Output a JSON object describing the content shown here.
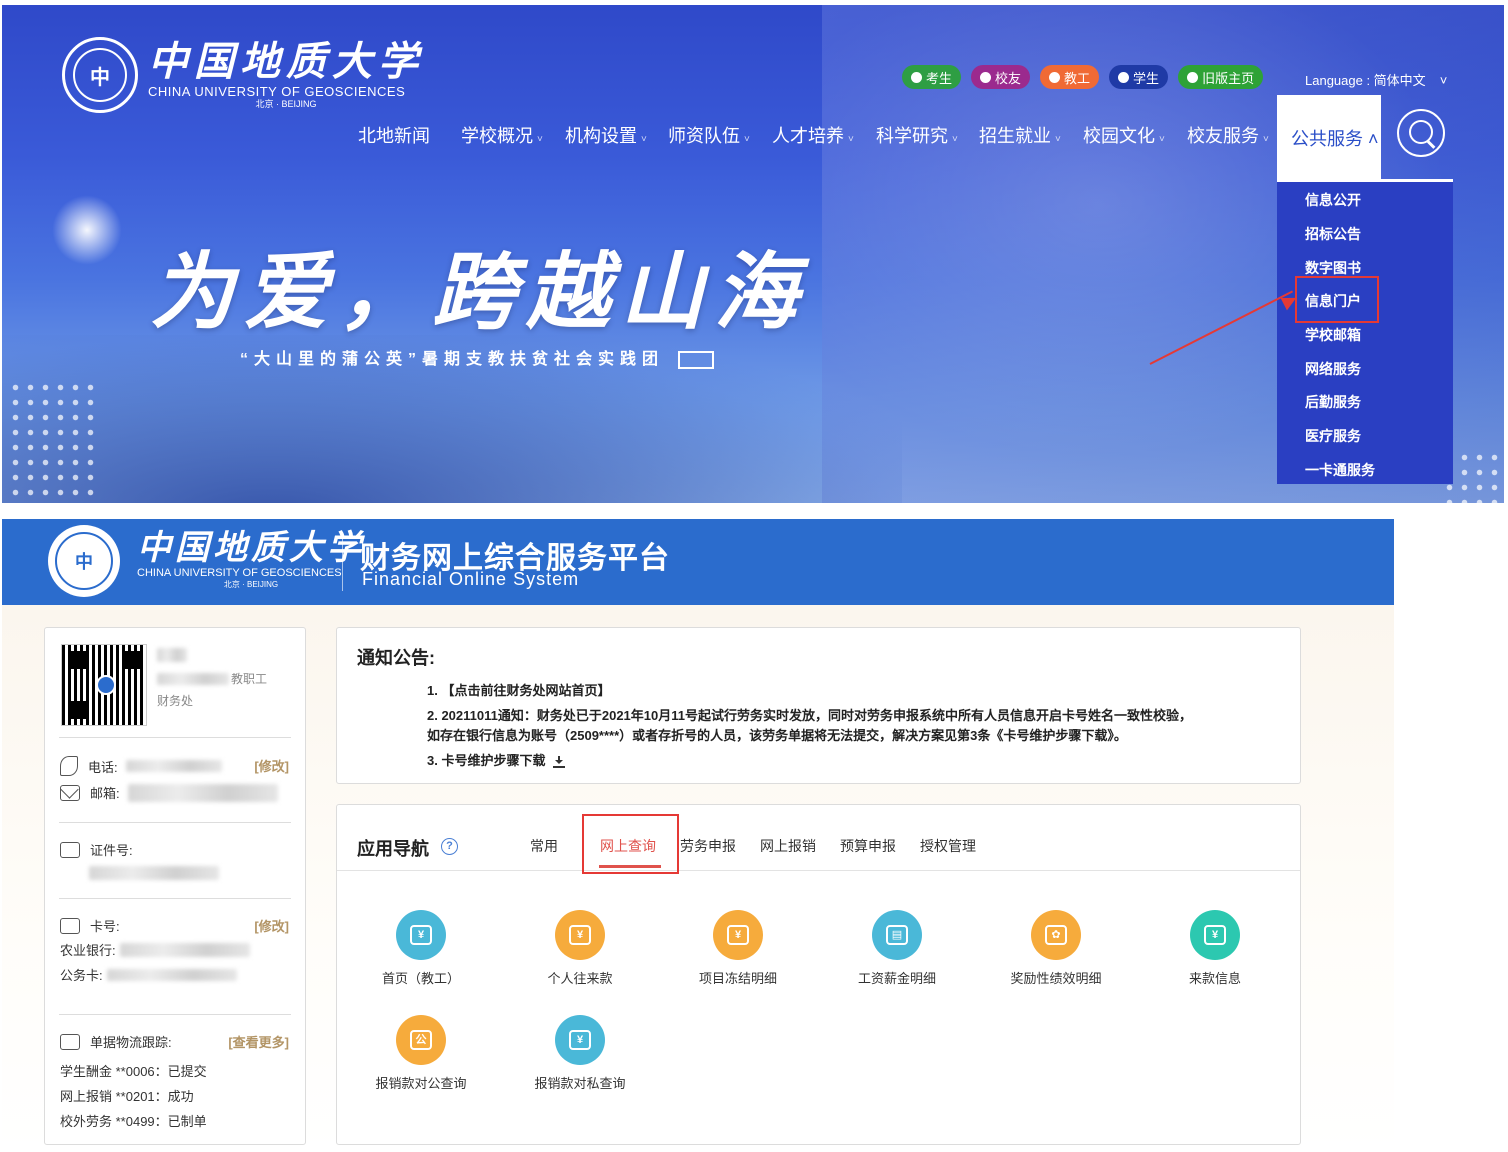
{
  "banner": {
    "logo": {
      "seal_text": "中",
      "cn": "中国地质大学",
      "en": "CHINA UNIVERSITY OF GEOSCIENCES",
      "city": "北京 · BEIJING"
    },
    "quick_links": [
      {
        "label": "考生",
        "color": "#2e9e43"
      },
      {
        "label": "校友",
        "color": "#9b2a8e"
      },
      {
        "label": "教工",
        "color": "#f06a35"
      },
      {
        "label": "学生",
        "color": "#1f3aa6"
      },
      {
        "label": "旧版主页",
        "color": "#2ea236"
      }
    ],
    "language": "Language : 简体中文",
    "language_chevron": "˅",
    "nav": [
      {
        "label": "北地新闻",
        "caret": ""
      },
      {
        "label": "学校概况",
        "caret": "˅"
      },
      {
        "label": "机构设置",
        "caret": "˅"
      },
      {
        "label": "师资队伍",
        "caret": "˅"
      },
      {
        "label": "人才培养",
        "caret": "˅"
      },
      {
        "label": "科学研究",
        "caret": "˅"
      },
      {
        "label": "招生就业",
        "caret": "˅"
      },
      {
        "label": "校园文化",
        "caret": "˅"
      },
      {
        "label": "校友服务",
        "caret": "˅"
      }
    ],
    "nav_active": "公共服务 ˄",
    "dropdown": [
      "信息公开",
      "招标公告",
      "数字图书",
      "信息门户",
      "学校邮箱",
      "网络服务",
      "后勤服务",
      "医疗服务",
      "一卡通服务"
    ],
    "slogan": "为爱，跨越山海",
    "sub_slogan": "“大山里的蒲公英”暑期支教扶贫社会实践团"
  },
  "finance": {
    "seal_text": "中",
    "cn": "中国地质大学",
    "en": "CHINA UNIVERSITY OF GEOSCIENCES",
    "city": "北京 · BEIJING",
    "title": "财务网上综合服务平台",
    "subtitle": "Financial Online System"
  },
  "profile": {
    "role": "教职工",
    "dept": "财务处",
    "phone_label": "电话:",
    "email_label": "邮箱:",
    "id_label": "证件号:",
    "card_label": "卡号:",
    "bank_label": "农业银行:",
    "official_card_label": "公务卡:",
    "modify": "[修改]",
    "track_label": "单据物流跟踪:",
    "view_more": "[查看更多]",
    "tracks": [
      "学生酬金 **0006：已提交",
      "网上报销 **0201：成功",
      "校外劳务 **0499：已制单"
    ]
  },
  "notice": {
    "title": "通知公告:",
    "lines": [
      "1. 【点击前往财务处网站首页】",
      "2. 20211011通知：财务处已于2021年10月11号起试行劳务实时发放，同时对劳务申报系统中所有人员信息开启卡号姓名一致性校验，",
      "如存在银行信息为账号（2509****）或者存折号的人员，该劳务单据将无法提交，解决方案见第3条《卡号维护步骤下载》。",
      "3. 卡号维护步骤下载"
    ]
  },
  "apps": {
    "title": "应用导航",
    "help": "?",
    "tabs": [
      "常用",
      "网上查询",
      "劳务申报",
      "网上报销",
      "预算申报",
      "授权管理"
    ],
    "active_tab": 1,
    "items": [
      {
        "label": "首页（教工）",
        "icon": "¥",
        "color": "teal"
      },
      {
        "label": "个人往来款",
        "icon": "¥",
        "color": "orange"
      },
      {
        "label": "项目冻结明细",
        "icon": "¥",
        "color": "orange"
      },
      {
        "label": "工资薪金明细",
        "icon": "▤",
        "color": "teal"
      },
      {
        "label": "奖励性绩效明细",
        "icon": "✿",
        "color": "orange"
      },
      {
        "label": "来款信息",
        "icon": "¥",
        "color": "green"
      },
      {
        "label": "报销款对公查询",
        "icon": "公",
        "color": "orange"
      },
      {
        "label": "报销款对私查询",
        "icon": "¥",
        "color": "teal"
      }
    ]
  }
}
